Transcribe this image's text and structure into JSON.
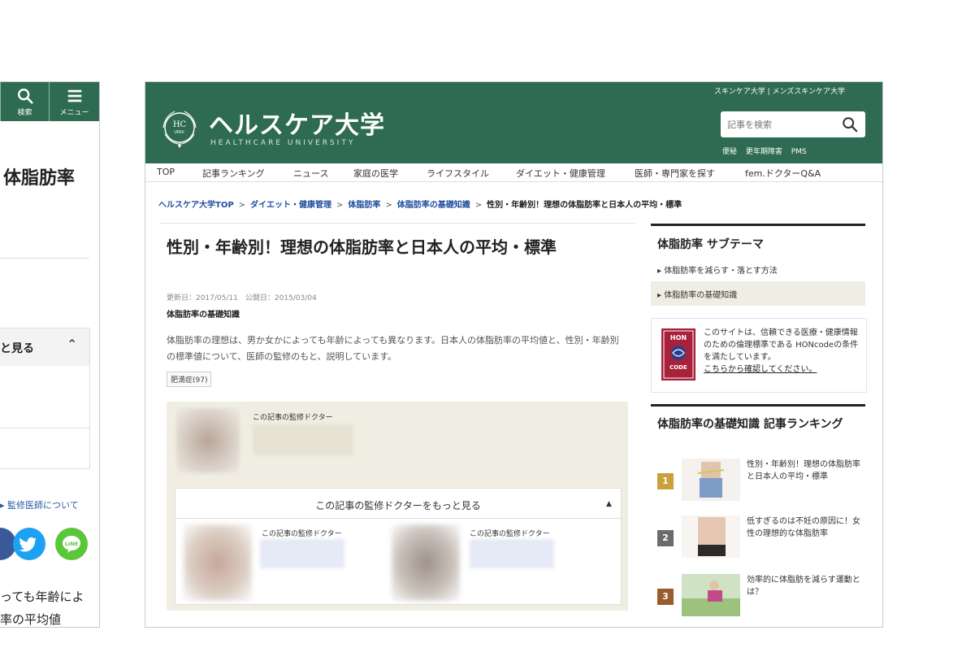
{
  "mobile": {
    "search_label": "検索",
    "menu_label": "メニュー",
    "title_fragment": "体脂肪率",
    "box_label_fragment": "と見る",
    "doctor_link": "監修医師について",
    "body_line1": "っても年齢によ",
    "body_line2": "率の平均値"
  },
  "desktop": {
    "logo": {
      "emblem_text_top": "HC",
      "emblem_text_bottom": "UNIV.",
      "name": "ヘルスケア大学",
      "subtitle": "HEALTHCARE UNIVERSITY"
    },
    "top_links": "スキンケア大学 | メンズスキンケア大学",
    "search": {
      "placeholder": "記事を検索"
    },
    "sub_links": [
      "便秘",
      "更年期障害",
      "PMS"
    ],
    "nav": [
      "TOP",
      "記事ランキング",
      "ニュース",
      "家庭の医学",
      "ライフスタイル",
      "ダイエット・健康管理",
      "医師・専門家を探す",
      "fem.ドクターQ&A"
    ],
    "breadcrumb": [
      "ヘルスケア大学TOP",
      "ダイエット・健康管理",
      "体脂肪率",
      "体脂肪率の基礎知識"
    ],
    "breadcrumb_sep": ">",
    "breadcrumb_current": "性別・年齢別！理想の体脂肪率と日本人の平均・標準",
    "article": {
      "title": "性別・年齢別！理想の体脂肪率と日本人の平均・標準",
      "dates": "更新日：2017/05/11　公開日：2015/03/04",
      "category": "体脂肪率の基礎知識",
      "lead": "体脂肪率の理想は、男か女かによっても年齢によっても異なります。日本人の体脂肪率の平均値と、性別・年齢別の標準値について、医師の監修のもと、説明しています。",
      "tag": "肥満症(97)"
    },
    "doctor": {
      "label": "この記事の監修ドクター",
      "more_label": "この記事の監修ドクターをもっと見る",
      "more_chevron": "▲"
    },
    "sidebar": {
      "theme_title": "体脂肪率 サブテーマ",
      "theme_items": [
        "体脂肪率を減らす・落とす方法",
        "体脂肪率の基礎知識"
      ],
      "hon_badge_top": "HON",
      "hon_badge_bottom": "CODE",
      "hon_text": "このサイトは、信頼できる医療・健康情報のための倫理標準である HONcodeの条件を満たしています。",
      "hon_link": "こちらから確認してください。",
      "ranking_title": "体脂肪率の基礎知識 記事ランキング",
      "ranking": [
        {
          "rank": "1",
          "title": "性別・年齢別！理想の体脂肪率と日本人の平均・標準",
          "color": "#c9a13b"
        },
        {
          "rank": "2",
          "title": "低すぎるのは不妊の原因に！女性の理想的な体脂肪率",
          "color": "#6b6b6b"
        },
        {
          "rank": "3",
          "title": "効率的に体脂肪を減らす運動とは？",
          "color": "#9a5b2f"
        }
      ]
    }
  },
  "colors": {
    "header_green": "#2e6b52",
    "link_blue": "#1f4d9e",
    "beige": "#f0eee2"
  }
}
